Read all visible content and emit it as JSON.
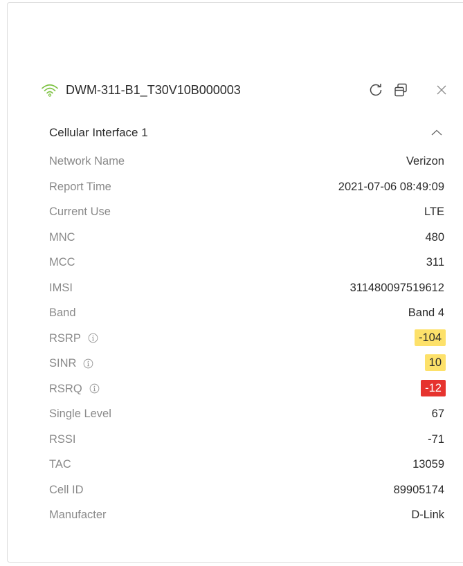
{
  "header": {
    "device_name": "DWM-311-B1_T30V10B000003",
    "icons": {
      "signal": "wifi-signal-icon",
      "refresh": "refresh-icon",
      "popout": "popout-window-icon",
      "close": "close-icon"
    },
    "signal_color": "#7dc242"
  },
  "section": {
    "title": "Cellular Interface 1",
    "collapse_icon": "chevron-up-icon"
  },
  "rows": [
    {
      "label": "Network Name",
      "value": "Verizon"
    },
    {
      "label": "Report Time",
      "value": "2021-07-06 08:49:09"
    },
    {
      "label": "Current Use",
      "value": "LTE"
    },
    {
      "label": "MNC",
      "value": "480"
    },
    {
      "label": "MCC",
      "value": "311"
    },
    {
      "label": "IMSI",
      "value": "311480097519612"
    },
    {
      "label": "Band",
      "value": "Band 4"
    },
    {
      "label": "RSRP",
      "value": "-104",
      "badge": "yellow"
    },
    {
      "label": "SINR",
      "value": "10",
      "badge": "yellow"
    },
    {
      "label": "RSRQ",
      "value": "-12",
      "badge": "red"
    },
    {
      "label": "Single Level",
      "value": "67"
    },
    {
      "label": "RSSI",
      "value": "-71"
    },
    {
      "label": "TAC",
      "value": "13059"
    },
    {
      "label": "Cell ID",
      "value": "89905174"
    },
    {
      "label": "Manufacter",
      "value": "D-Link"
    }
  ],
  "colors": {
    "badge_yellow": "#fde16a",
    "badge_red": "#e6332e",
    "label_gray": "#8a8a8a"
  }
}
